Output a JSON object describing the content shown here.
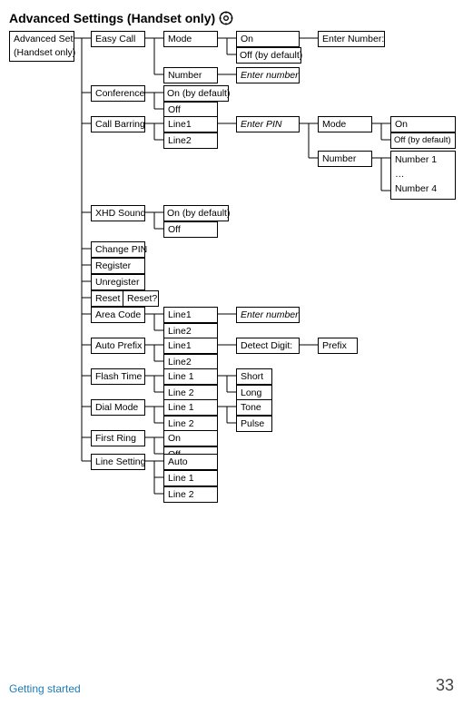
{
  "title": "Advanced Settings (Handset only)",
  "footer": {
    "left": "Getting started",
    "page": "33"
  },
  "nodes": {
    "root1": "Advanced Set",
    "root2": "(Handset only)",
    "easyCall": "Easy Call",
    "mode1": "Mode",
    "on1": "On",
    "offDef1": "Off (by default)",
    "enterNum1": "Enter Number:",
    "number1": "Number",
    "enterNumIt1": "Enter number",
    "conference": "Conference",
    "onDef1": "On (by default)",
    "off1": "Off",
    "callBarring": "Call Barring",
    "line1a": "Line1",
    "line2a": "Line2",
    "enterPin": "Enter PIN",
    "mode2": "Mode",
    "on2": "On",
    "offDef2": "Off (by default)",
    "number2": "Number",
    "numList1": "Number 1",
    "numListDots": "…",
    "numList4": "Number 4",
    "xhd": "XHD Sound",
    "onDef2": "On (by default)",
    "off2": "Off",
    "changePin": "Change PIN",
    "register": "Register",
    "unregister": "Unregister",
    "reset": "Reset",
    "resetQ": "Reset?",
    "areaCode": "Area Code",
    "line1b": "Line1",
    "line2b": "Line2",
    "enterNumIt2": "Enter number",
    "autoPrefix": "Auto Prefix",
    "line1c": "Line1",
    "line2c": "Line2",
    "detectDigit": "Detect Digit:",
    "prefix": "Prefix",
    "flashTime": "Flash Time",
    "line1d": "Line 1",
    "line2d": "Line 2",
    "short": "Short",
    "long": "Long",
    "dialMode": "Dial Mode",
    "line1e": "Line 1",
    "line2e": "Line 2",
    "tone": "Tone",
    "pulse": "Pulse",
    "firstRing": "First Ring",
    "on3": "On",
    "off3": "Off",
    "lineSetting": "Line Setting",
    "auto": "Auto",
    "line1f": "Line 1",
    "line2f": "Line 2"
  }
}
